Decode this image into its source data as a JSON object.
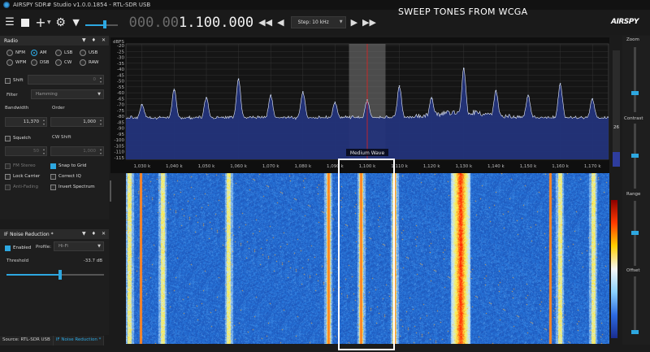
{
  "app": {
    "title": "AIRSPY SDR# Studio v1.0.0.1854 - RTL-SDR USB",
    "overlay_title": "SWEEP TONES FROM WCGA",
    "brand": "AIRSPY"
  },
  "toolbar": {
    "freq_dim": "000.00",
    "freq_bright": "1.100.000",
    "step_label": "Step: 10 kHz",
    "volume_level": 0.6
  },
  "radio_panel": {
    "title": "Radio",
    "modes": [
      {
        "label": "NFM",
        "selected": false
      },
      {
        "label": "AM",
        "selected": true
      },
      {
        "label": "LSB",
        "selected": false
      },
      {
        "label": "USB",
        "selected": false
      },
      {
        "label": "WFM",
        "selected": false
      },
      {
        "label": "DSB",
        "selected": false
      },
      {
        "label": "CW",
        "selected": false
      },
      {
        "label": "RAW",
        "selected": false
      }
    ],
    "shift_label": "Shift",
    "shift_value": "0",
    "filter_label": "Filter",
    "filter_value": "Hamming",
    "bandwidth_label": "Bandwidth",
    "bandwidth_value": "11,370",
    "order_label": "Order",
    "order_value": "1,000",
    "squelch_label": "Squelch",
    "cw_shift_label": "CW Shift",
    "squelch_value": "50",
    "cw_shift_value": "1,000",
    "fm_stereo": "FM Stereo",
    "snap_to_grid": "Snap to Grid",
    "lock_carrier": "Lock Carrier",
    "correct_iq": "Correct IQ",
    "anti_fading": "Anti-Fading",
    "invert_spectrum": "Invert Spectrum"
  },
  "nr_panel": {
    "title": "IF Noise Reduction *",
    "enabled_label": "Enabled",
    "profile_label": "Profile:",
    "profile_value": "Hi-Fi",
    "threshold_label": "Threshold",
    "threshold_value": "-33.7 dB",
    "threshold_level": 0.55
  },
  "status_tabs": [
    "Source: RTL-SDR USB",
    "IF Noise Reduction *"
  ],
  "side": {
    "zoom": "Zoom",
    "contrast": "Contrast",
    "range": "Range",
    "offset": "Offset",
    "level_readout": "26"
  },
  "chart_data": {
    "type": "line",
    "ylabel": "dBFS",
    "y_ticks": [
      "-20",
      "-25",
      "-30",
      "-35",
      "-40",
      "-45",
      "-50",
      "-55",
      "-60",
      "-65",
      "-70",
      "-75",
      "-80",
      "-85",
      "-90",
      "-95",
      "-100",
      "-105",
      "-110",
      "-115"
    ],
    "ylim": [
      -115,
      -20
    ],
    "x_ticks": [
      "1,030 k",
      "1,040 k",
      "1,050 k",
      "1,060 k",
      "1,070 k",
      "1,080 k",
      "1,090 k",
      "1,100 k",
      "1,110 k",
      "1,120 k",
      "1,130 k",
      "1,140 k",
      "1,150 k",
      "1,160 k",
      "1,170 k"
    ],
    "xlim_khz": [
      1025,
      1175
    ],
    "band_label": "Medium Wave",
    "center_khz": 1100,
    "filter_width_khz": 11.37,
    "noise_floor_dbfs": -80,
    "peaks": [
      {
        "x": 1030,
        "y": -68
      },
      {
        "x": 1040,
        "y": -55
      },
      {
        "x": 1050,
        "y": -62
      },
      {
        "x": 1060,
        "y": -46
      },
      {
        "x": 1070,
        "y": -60
      },
      {
        "x": 1080,
        "y": -57
      },
      {
        "x": 1090,
        "y": -66
      },
      {
        "x": 1100,
        "y": -64
      },
      {
        "x": 1110,
        "y": -52
      },
      {
        "x": 1120,
        "y": -62
      },
      {
        "x": 1130,
        "y": -37
      },
      {
        "x": 1140,
        "y": -56
      },
      {
        "x": 1150,
        "y": -60
      },
      {
        "x": 1160,
        "y": -50
      },
      {
        "x": 1170,
        "y": -63
      }
    ],
    "grid": true
  },
  "waterfall": {
    "bright_stations_khz": [
      1030,
      1040,
      1060,
      1090,
      1100,
      1110,
      1130,
      1160,
      1170
    ],
    "strong_station_khz": 1130
  },
  "colors": {
    "accent": "#2da7e0",
    "spectrum_fill": "#23337a",
    "waterfall_bg": "#1f4fb5",
    "highlight_box": "#ffffff"
  }
}
